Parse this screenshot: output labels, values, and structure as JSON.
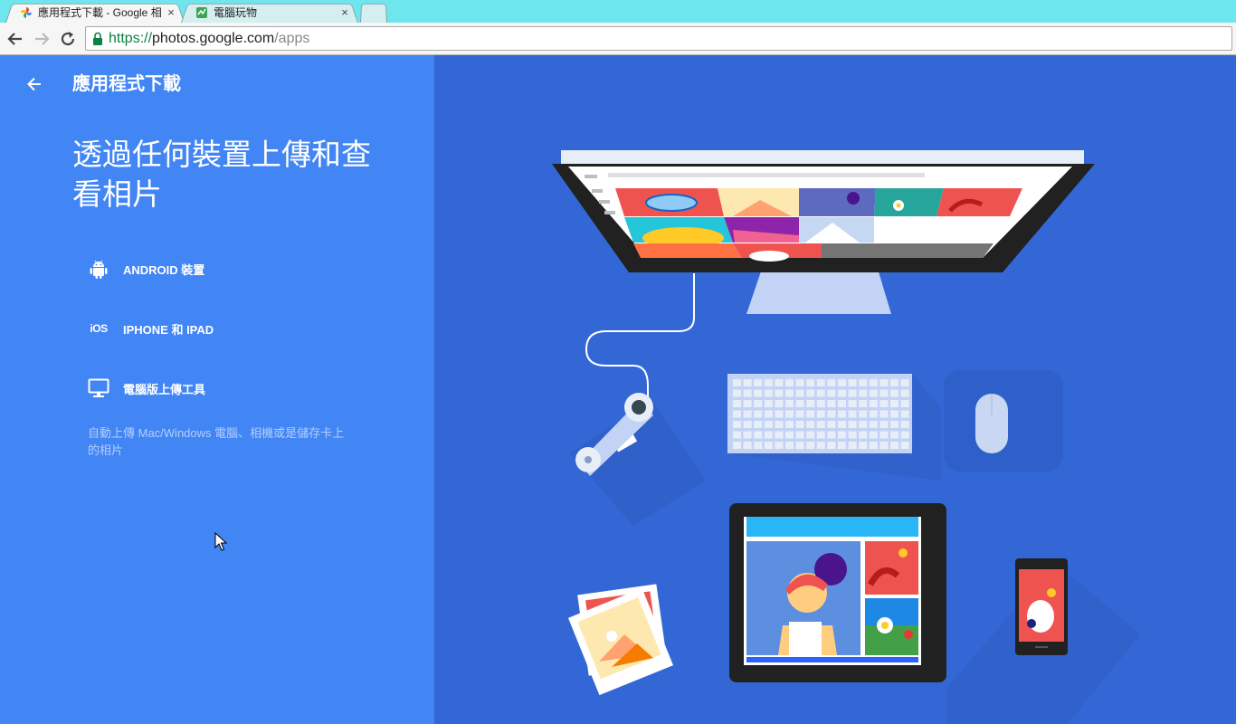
{
  "browser": {
    "tabs": [
      {
        "title": "應用程式下載 - Google 相",
        "close": "×",
        "favicon": "google-photos-icon"
      },
      {
        "title": "電腦玩物",
        "close": "×",
        "favicon": "site-icon"
      }
    ],
    "url": {
      "scheme": "https://",
      "host": "photos.google.com",
      "path": "/apps"
    }
  },
  "page": {
    "header_title": "應用程式下載",
    "hero_title": "透過任何裝置上傳和查看相片",
    "items": [
      {
        "label": "ANDROID 裝置",
        "icon": "android-icon"
      },
      {
        "label": "IPHONE 和 IPAD",
        "icon": "ios-icon",
        "glyph": "iOS"
      },
      {
        "label": "電腦版上傳工具",
        "icon": "desktop-icon"
      }
    ],
    "desktop_description": "自動上傳 Mac/Windows 電腦、相機或是儲存卡上的相片"
  },
  "colors": {
    "left_panel": "#4285f4",
    "right_panel": "#3367d6",
    "tabstrip": "#6ee6ee"
  }
}
